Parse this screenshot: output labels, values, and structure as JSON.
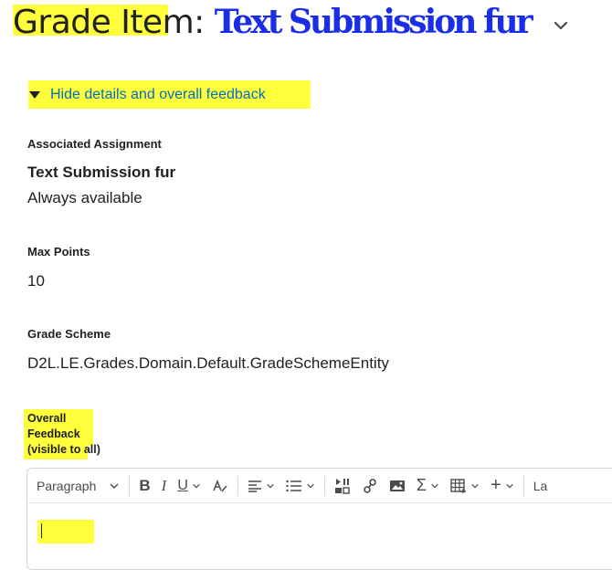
{
  "header": {
    "title_prefix": "Grade Item:",
    "title_name": "Text Submission fur"
  },
  "details_toggle": {
    "label": "Hide details and overall feedback"
  },
  "fields": {
    "associated_assignment": {
      "label": "Associated Assignment",
      "name": "Text Submission fur",
      "availability": "Always available"
    },
    "max_points": {
      "label": "Max Points",
      "value": "10"
    },
    "grade_scheme": {
      "label": "Grade Scheme",
      "value": "D2L.LE.Grades.Domain.Default.GradeSchemeEntity"
    }
  },
  "feedback": {
    "label_line1": "Overall",
    "label_line2": "Feedback",
    "label_line3": "(visible to all)"
  },
  "editor_toolbar": {
    "format_select": "Paragraph",
    "lang_cut": "La"
  },
  "colors": {
    "highlight": "#ffff3b",
    "link": "#006fbf",
    "scribble": "#1a2ee8"
  }
}
